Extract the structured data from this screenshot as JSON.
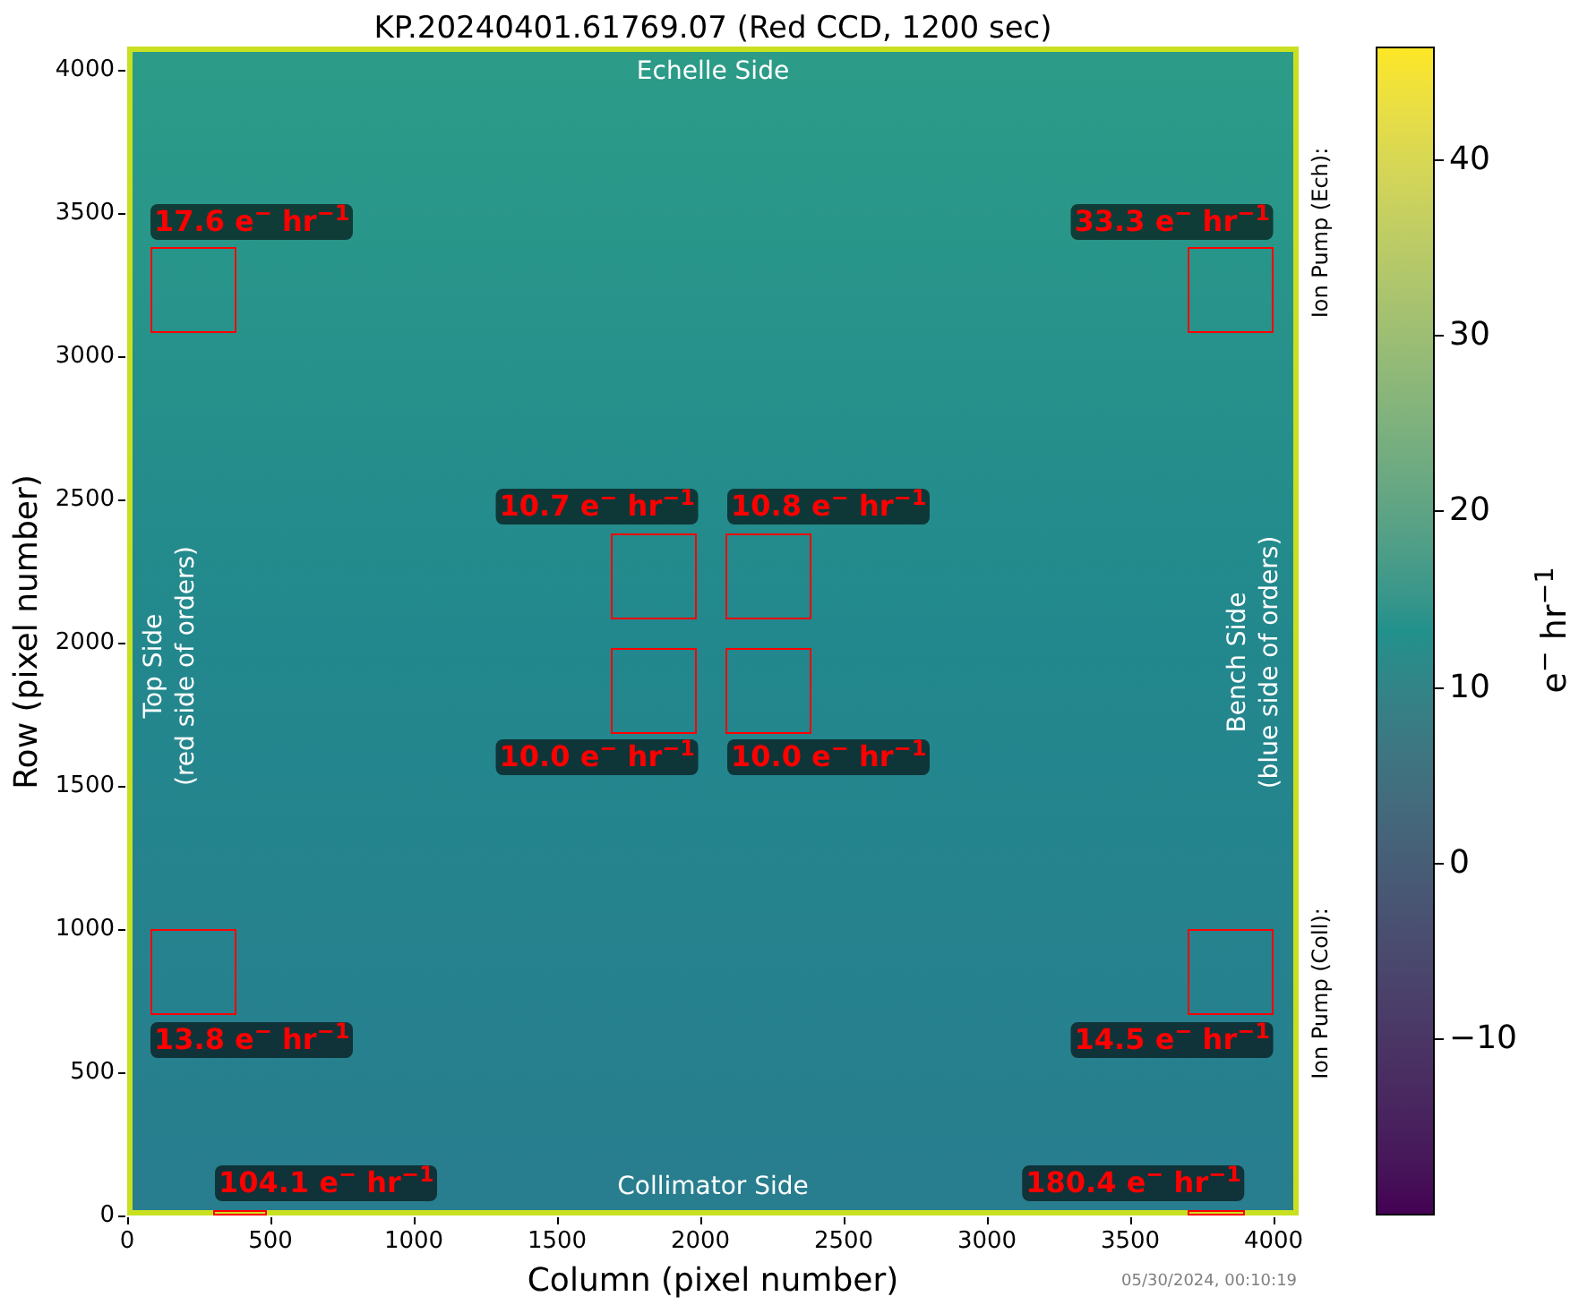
{
  "title": "KP.20240401.61769.07 (Red CCD, 1200 sec)",
  "x_axis": {
    "label": "Column (pixel number)",
    "ticks": [
      "0",
      "500",
      "1000",
      "1500",
      "2000",
      "2500",
      "3000",
      "3500",
      "4000"
    ]
  },
  "y_axis": {
    "label": "Row (pixel number)",
    "ticks": [
      "4000",
      "3500",
      "3000",
      "2500",
      "2000",
      "1500",
      "1000",
      "500",
      "0"
    ]
  },
  "side_labels": [
    {
      "lines": [
        "Echelle Side"
      ]
    },
    {
      "lines": [
        "Top Side",
        "(red side of orders)"
      ]
    },
    {
      "lines": [
        "Bench Side",
        "(blue side of orders)"
      ]
    },
    {
      "lines": [
        "Collimator Side"
      ]
    }
  ],
  "regions": [
    {
      "label": "17.6 e$^{−}$ hr$^{−1}$"
    },
    {
      "label": "33.3 e$^{−}$ hr$^{−1}$"
    },
    {
      "label": "10.7 e$^{−}$ hr$^{−1}$"
    },
    {
      "label": "10.8 e$^{−}$ hr$^{−1}$"
    },
    {
      "label": "10.0 e$^{−}$ hr$^{−1}$"
    },
    {
      "label": "10.0 e$^{−}$ hr$^{−1}$"
    },
    {
      "label": "13.8 e$^{−}$ hr$^{−1}$"
    },
    {
      "label": "14.5 e$^{−}$ hr$^{−1}$"
    },
    {
      "label": "104.1 e$^{−}$ hr$^{−1}$"
    },
    {
      "label": "180.4 e$^{−}$ hr$^{−1}$"
    }
  ],
  "side_notes": [
    "Ion Pump (Ech):",
    "Ion Pump (Coll):"
  ],
  "colorbar": {
    "label": "e$^{−}$ hr$^{−1}$",
    "ticks": [
      "40",
      "30",
      "20",
      "10",
      "0",
      "−10"
    ]
  },
  "timestamp": "05/30/2024, 00:10:19"
}
